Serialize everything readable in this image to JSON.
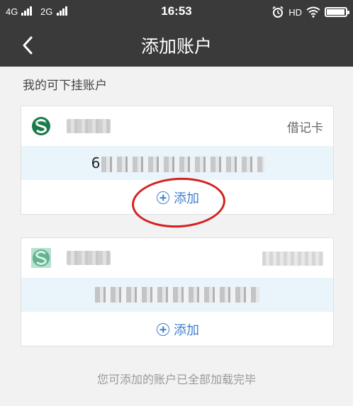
{
  "status_bar": {
    "net1": "4G",
    "net2": "2G",
    "time": "16:53",
    "hd": "HD",
    "battery_level": 0.9
  },
  "nav": {
    "title": "添加账户"
  },
  "section": {
    "label": "我的可下挂账户"
  },
  "accounts": [
    {
      "card_type": "借记卡",
      "number_visible_prefix": "6",
      "add_label": "添加",
      "logo_color": "#1a7a4a"
    },
    {
      "add_label": "添加",
      "logo_color": "#2a9a6a"
    }
  ],
  "footer": {
    "note": "您可添加的账户已全部加载完毕"
  },
  "colors": {
    "header_bg": "#3a3a3a",
    "accent": "#3f7fcf",
    "highlight": "#d42020"
  }
}
